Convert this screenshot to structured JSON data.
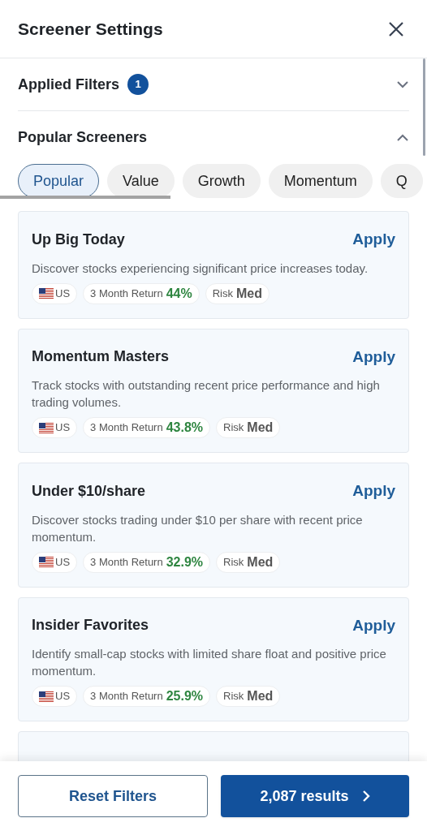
{
  "header": {
    "title": "Screener Settings"
  },
  "sections": [
    {
      "title": "Applied Filters",
      "badge": "1",
      "expanded": false
    },
    {
      "title": "Popular Screeners",
      "expanded": true
    }
  ],
  "chips": [
    {
      "label": "Popular",
      "selected": true
    },
    {
      "label": "Value",
      "selected": false
    },
    {
      "label": "Growth",
      "selected": false
    },
    {
      "label": "Momentum",
      "selected": false
    },
    {
      "label": "Q",
      "selected": false
    }
  ],
  "screeners": [
    {
      "title": "Up Big Today",
      "action": "Apply",
      "description": "Discover stocks experiencing significant price increases today.",
      "region": "US",
      "return_label": "3 Month Return",
      "return_value": "44%",
      "risk_label": "Risk",
      "risk_value": "Med"
    },
    {
      "title": "Momentum Masters",
      "action": "Apply",
      "description": "Track stocks with outstanding recent price performance and high trading volumes.",
      "region": "US",
      "return_label": "3 Month Return",
      "return_value": "43.8%",
      "risk_label": "Risk",
      "risk_value": "Med"
    },
    {
      "title": "Under $10/share",
      "action": "Apply",
      "description": "Discover stocks trading under $10 per share with recent price momentum.",
      "region": "US",
      "return_label": "3 Month Return",
      "return_value": "32.9%",
      "risk_label": "Risk",
      "risk_value": "Med"
    },
    {
      "title": "Insider Favorites",
      "action": "Apply",
      "description": "Identify small-cap stocks with limited share float and positive price momentum.",
      "region": "US",
      "return_label": "3 Month Return",
      "return_value": "25.9%",
      "risk_label": "Risk",
      "risk_value": "Med"
    }
  ],
  "footer": {
    "reset": "Reset Filters",
    "results": "2,087 results"
  }
}
